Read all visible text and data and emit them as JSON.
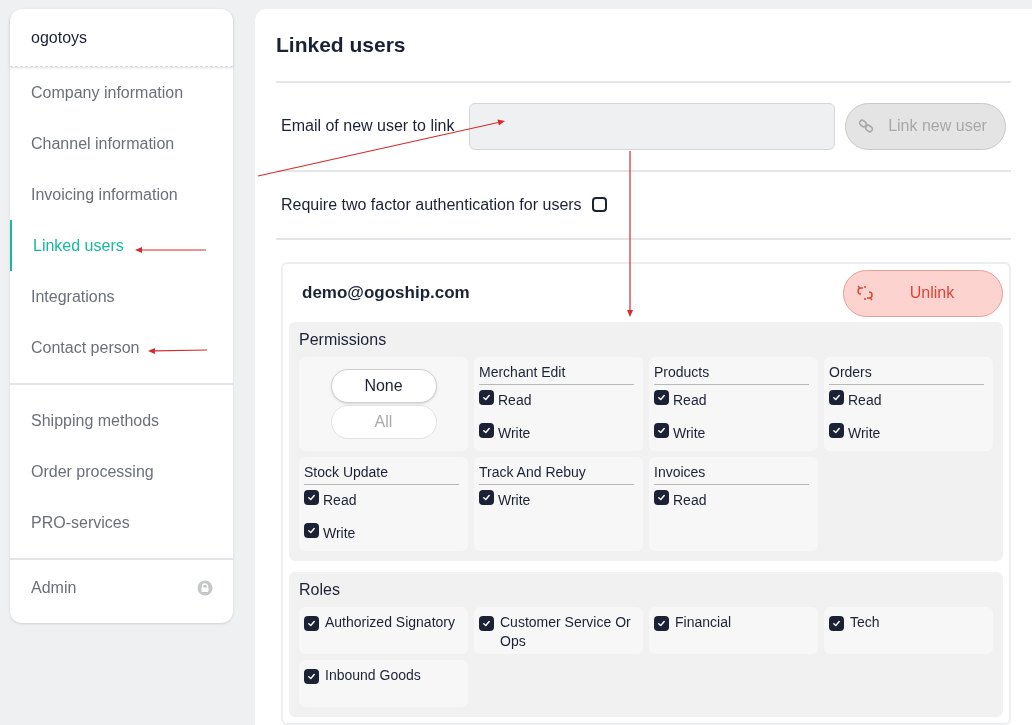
{
  "sidebar": {
    "account": "ogotoys",
    "groups": [
      [
        {
          "label": "Company information",
          "selected": false
        },
        {
          "label": "Channel information",
          "selected": false
        },
        {
          "label": "Invoicing information",
          "selected": false
        },
        {
          "label": "Linked users",
          "selected": true
        },
        {
          "label": "Integrations",
          "selected": false
        },
        {
          "label": "Contact person",
          "selected": false
        }
      ],
      [
        {
          "label": "Shipping methods",
          "selected": false
        },
        {
          "label": "Order processing",
          "selected": false
        },
        {
          "label": "PRO-services",
          "selected": false
        }
      ],
      [
        {
          "label": "Admin",
          "selected": false,
          "locked": true
        }
      ]
    ]
  },
  "main": {
    "title": "Linked users",
    "email_field": {
      "label": "Email of new user to link"
    },
    "link_button": {
      "label": "Link new user",
      "disabled": true
    },
    "two_factor": {
      "label": "Require two factor authentication for users",
      "checked": false
    },
    "user": {
      "email": "demo@ogoship.com",
      "unlink_button": "Unlink",
      "permissions": {
        "title": "Permissions",
        "none_button": {
          "label": "None",
          "disabled": false
        },
        "all_button": {
          "label": "All",
          "disabled": true
        },
        "groups": [
          {
            "name": "Merchant Edit",
            "options": [
              {
                "label": "Read",
                "checked": true
              },
              {
                "label": "Write",
                "checked": true
              }
            ]
          },
          {
            "name": "Products",
            "options": [
              {
                "label": "Read",
                "checked": true
              },
              {
                "label": "Write",
                "checked": true
              }
            ]
          },
          {
            "name": "Orders",
            "options": [
              {
                "label": "Read",
                "checked": true
              },
              {
                "label": "Write",
                "checked": true
              }
            ]
          },
          {
            "name": "Stock Update",
            "options": [
              {
                "label": "Read",
                "checked": true
              },
              {
                "label": "Write",
                "checked": true
              }
            ]
          },
          {
            "name": "Track And Rebuy",
            "options": [
              {
                "label": "Write",
                "checked": true
              }
            ]
          },
          {
            "name": "Invoices",
            "options": [
              {
                "label": "Read",
                "checked": true
              }
            ]
          }
        ]
      },
      "roles": {
        "title": "Roles",
        "items": [
          {
            "label": "Authorized Signatory",
            "checked": true
          },
          {
            "label": "Customer Service Or Ops",
            "checked": true
          },
          {
            "label": "Financial",
            "checked": true
          },
          {
            "label": "Tech",
            "checked": true
          },
          {
            "label": "Inbound Goods",
            "checked": true
          }
        ]
      }
    }
  }
}
